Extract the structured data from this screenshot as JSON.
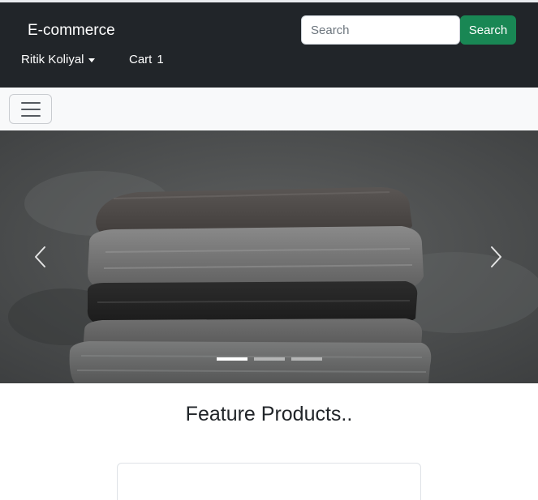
{
  "navbar": {
    "brand": "E-commerce",
    "search_placeholder": "Search",
    "search_button": "Search",
    "user_name": "Ritik Koliyal",
    "cart_label": "Cart",
    "cart_count": "1"
  },
  "carousel": {
    "slides_count": 3,
    "active_index": 0
  },
  "main": {
    "section_title": "Feature Products.."
  },
  "colors": {
    "navbar_bg": "#212529",
    "search_button_bg": "#198754",
    "toolbar_bg": "#f8f9fa"
  },
  "icons": {
    "toggler": "hamburger-icon",
    "prev": "chevron-left-icon",
    "next": "chevron-right-icon",
    "user_dropdown": "caret-down-icon"
  }
}
